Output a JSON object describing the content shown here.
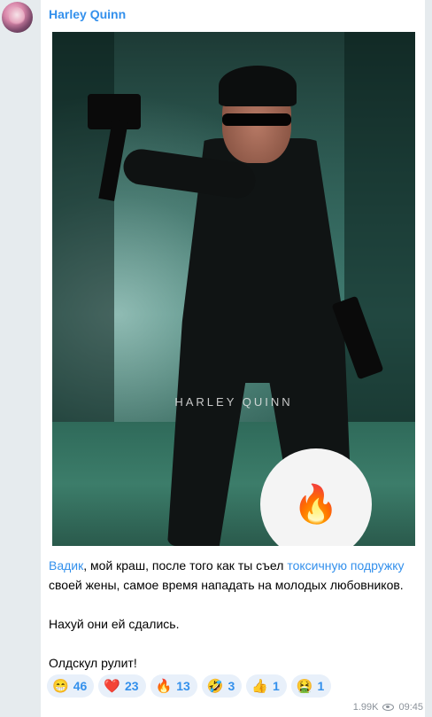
{
  "sender": {
    "name": "Harley Quinn"
  },
  "photo": {
    "watermark": "HARLEY QUINN",
    "overlay_emoji": "🔥"
  },
  "caption": {
    "link1": "Вадик",
    "text1": ", мой краш, после того как ты съел ",
    "link2": "токсичную подружку",
    "text2": " своей жены, самое время нападать на молодых любовников.",
    "line2": "Нахуй они ей сдались.",
    "line3": "Олдскул рулит!"
  },
  "reactions": [
    {
      "emoji": "😁",
      "count": "46"
    },
    {
      "emoji": "❤️",
      "count": "23"
    },
    {
      "emoji": "🔥",
      "count": "13"
    },
    {
      "emoji": "🤣",
      "count": "3"
    },
    {
      "emoji": "👍",
      "count": "1"
    },
    {
      "emoji": "🤮",
      "count": "1"
    }
  ],
  "meta": {
    "views": "1.99K",
    "time": "09:45"
  },
  "colors": {
    "accent": "#3390ec",
    "background": "#e6ebee",
    "bubble": "#ffffff"
  }
}
